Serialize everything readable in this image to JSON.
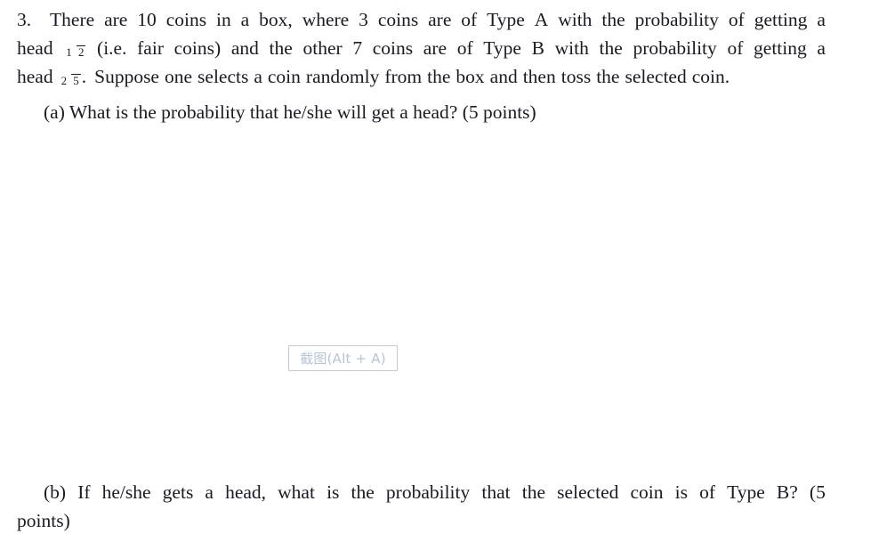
{
  "document": {
    "type": "probability-homework-question",
    "background_color": "#ffffff",
    "text_color": "#1a1a24"
  },
  "problem": {
    "number": "3.",
    "line1": [
      "There",
      "are",
      "10",
      "coins",
      "in",
      "a",
      "box,",
      "where",
      "3",
      "coins",
      "are",
      "of",
      "Type",
      "A",
      "with",
      "the",
      "probability",
      "of",
      "getting",
      "a"
    ],
    "line2_lead": "head",
    "line2_fraction": {
      "numerator": "1",
      "denominator": "2"
    },
    "line2": [
      "(i.e.",
      "fair",
      "coins)",
      "and",
      "the",
      "other",
      "7",
      "coins",
      "are",
      "of",
      "Type",
      "B",
      "with",
      "the",
      "probability",
      "of",
      "getting",
      "a"
    ],
    "line3_lead": "head",
    "line3_fraction": {
      "numerator": "2",
      "denominator": "5"
    },
    "line3": [
      ".",
      "Suppose",
      "one",
      "selects",
      "a",
      "coin",
      "randomly",
      "from",
      "the",
      "box",
      "and",
      "then",
      "toss",
      "the",
      "selected",
      "coin."
    ]
  },
  "part_a": {
    "label": "(a)",
    "text": "What is the probability that he/she will get a head?",
    "points": "(5 points)"
  },
  "screenshot_widget": {
    "label": "截图(Alt + A)",
    "border_color": "#c9cace",
    "text_color": "#b6c3da",
    "background_color": "#ffffff"
  },
  "part_b": {
    "line1": [
      "(b)",
      "If",
      "he/she",
      "gets",
      "a",
      "head,",
      "what",
      "is",
      "the",
      "probability",
      "that",
      "the",
      "selected",
      "coin",
      "is",
      "of",
      "Type",
      "B?",
      "(5"
    ],
    "line2": "points)"
  }
}
